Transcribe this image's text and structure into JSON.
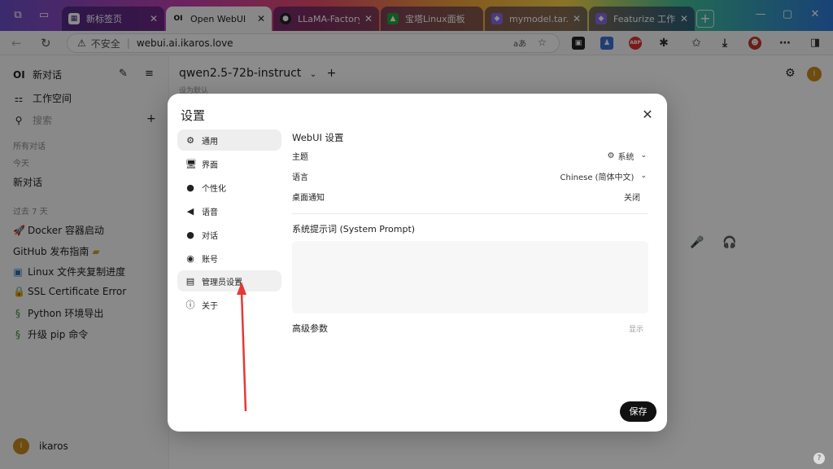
{
  "browser": {
    "tabs": [
      {
        "title": "新标签页"
      },
      {
        "title": "Open WebUI",
        "favicon": "OI"
      },
      {
        "title": "LLaMA-Factory/dat"
      },
      {
        "title": "宝塔Linux面板"
      },
      {
        "title": "mymodel.tar.zst"
      },
      {
        "title": "Featurize 工作区"
      }
    ],
    "new_tab": "+",
    "insecure_label": "不安全",
    "url": "webui.ai.ikaros.love",
    "read_aloud": "aあ"
  },
  "sidebar": {
    "logo": "OI",
    "new_chat": "新对话",
    "workspace": "工作空间",
    "search_placeholder": "搜索",
    "section_all": "所有对话",
    "section_today": "今天",
    "today_items": [
      "新对话"
    ],
    "section_7days": "过去 7 天",
    "past_items": [
      {
        "label": "Docker 容器启动",
        "icon": "rocket-icon"
      },
      {
        "label": "GitHub 发布指南",
        "icon": "folder-icon"
      },
      {
        "label": "Linux 文件夹复制进度",
        "icon": "terminal-icon"
      },
      {
        "label": "SSL Certificate Error",
        "icon": "lock-icon"
      },
      {
        "label": "Python 环境导出",
        "icon": "snake-icon"
      },
      {
        "label": "升级 pip 命令",
        "icon": "snake-icon"
      }
    ],
    "user_name": "ikaros",
    "user_initial": "I"
  },
  "header": {
    "model": "qwen2.5-72b-instruct",
    "set_default": "设为默认",
    "avatar_initial": "I"
  },
  "modal": {
    "title": "设置",
    "tabs": [
      {
        "label": "通用",
        "icon": "gear-icon"
      },
      {
        "label": "界面",
        "icon": "monitor-icon"
      },
      {
        "label": "个性化",
        "icon": "user-icon"
      },
      {
        "label": "语音",
        "icon": "speaker-icon"
      },
      {
        "label": "对话",
        "icon": "chat-icon"
      },
      {
        "label": "账号",
        "icon": "account-icon"
      },
      {
        "label": "管理员设置",
        "icon": "admin-card-icon"
      },
      {
        "label": "关于",
        "icon": "info-icon"
      }
    ],
    "webui_heading": "WebUI 设置",
    "theme_label": "主题",
    "theme_value": "系统",
    "language_label": "语言",
    "language_value": "Chinese (简体中文)",
    "notify_label": "桌面通知",
    "notify_value": "关闭",
    "system_prompt_label": "系统提示词 (System Prompt)",
    "system_prompt_value": "",
    "advanced_label": "高级参数",
    "advanced_toggle": "显示",
    "save_label": "保存"
  },
  "colors": {
    "arrow": "#e53935",
    "save_bg": "#111111",
    "overlay": "rgba(0,0,0,0.45)"
  }
}
